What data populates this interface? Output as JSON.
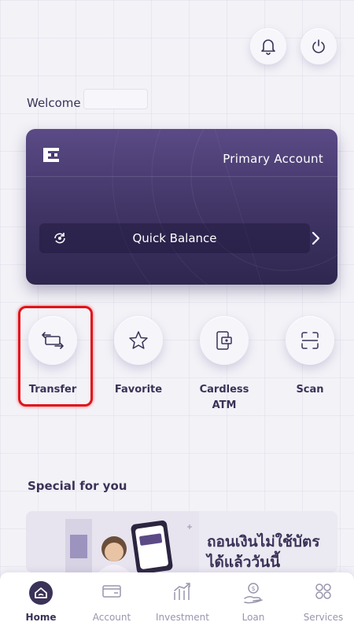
{
  "header": {
    "welcome_label": "Welcome"
  },
  "account_card": {
    "title": "Primary Account",
    "quick_balance_label": "Quick Balance"
  },
  "shortcuts": [
    {
      "label": "Transfer",
      "icon": "transfer-icon"
    },
    {
      "label": "Favorite",
      "icon": "star-icon"
    },
    {
      "label": "Cardless\nATM",
      "icon": "cardless-atm-icon"
    },
    {
      "label": "Scan",
      "icon": "scan-icon"
    }
  ],
  "special": {
    "title": "Special for you",
    "promo_line1": "ถอนเงินไม่ใช้บัตร",
    "promo_line2": "ได้แล้ววันนี้"
  },
  "bottom_nav": [
    {
      "label": "Home",
      "icon": "home-icon",
      "active": true
    },
    {
      "label": "Account",
      "icon": "wallet-icon"
    },
    {
      "label": "Investment",
      "icon": "investment-icon"
    },
    {
      "label": "Loan",
      "icon": "loan-icon"
    },
    {
      "label": "Services",
      "icon": "services-icon"
    }
  ],
  "colors": {
    "accent": "#3b3258",
    "card_top": "#5b4a86",
    "card_bottom": "#2f2750",
    "highlight": "#e0141a",
    "background": "#f3f2f7"
  }
}
